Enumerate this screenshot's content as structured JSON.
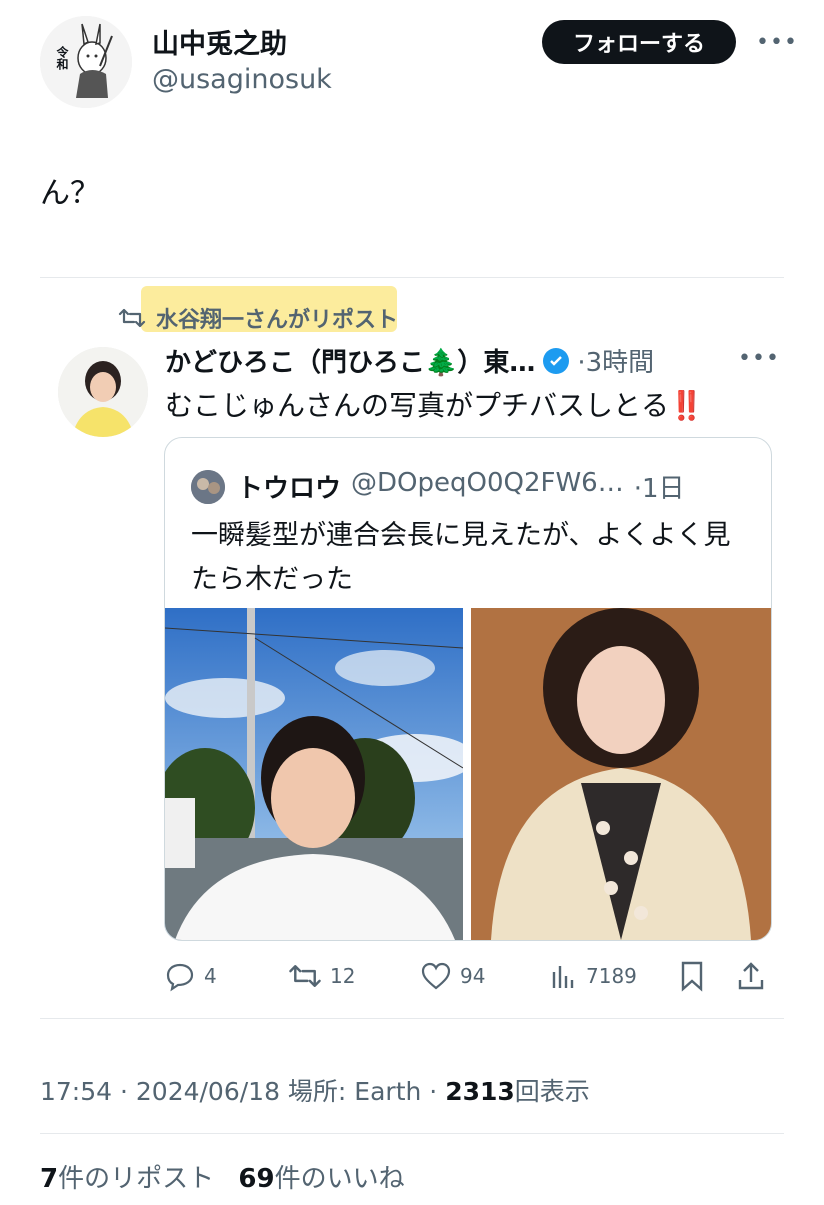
{
  "author": {
    "name": "山中兎之助",
    "handle": "@usaginosuk",
    "avatar_text": "令和",
    "follow_label": "フォローする",
    "more": "•••"
  },
  "tweet": {
    "text": "ん？"
  },
  "repost_indicator": {
    "text": "水谷翔一さんがリポスト"
  },
  "reposted_tweet": {
    "name": "かどひろこ（門ひろこ🌲）東…",
    "time": "·3時間",
    "more": "•••",
    "text": "むこじゅんさんの写真がプチバスしとる‼️"
  },
  "quoted_tweet": {
    "name": "トウロウ",
    "handle": "@DOpeqO0Q2FW6…",
    "time": "·1日",
    "text": "一瞬髪型が連合会長に見えたが、よくよく見たら木だった"
  },
  "actions": {
    "replies": "4",
    "reposts": "12",
    "likes": "94",
    "views": "7189"
  },
  "meta": {
    "time": "17:54 · 2024/06/18 場所: Earth · ",
    "views_count": "2313",
    "views_label": "回表示"
  },
  "stats": {
    "reposts_count": "7",
    "reposts_label": "件のリポスト",
    "likes_count": "69",
    "likes_label": "件のいいね"
  },
  "colors": {
    "accent": "#1d9bf0",
    "text": "#0f1419",
    "muted": "#536471",
    "highlight": "#fbe98c"
  }
}
